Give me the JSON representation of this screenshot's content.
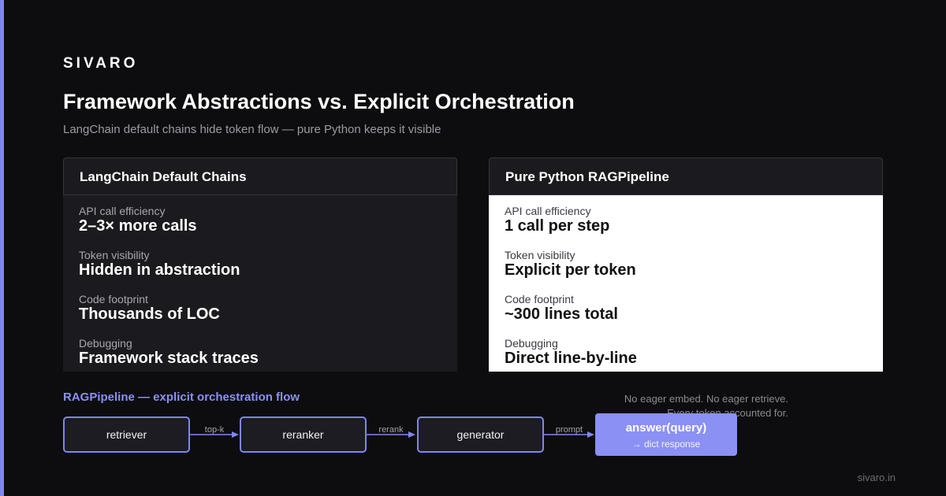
{
  "brand": "SIVARO",
  "title": "Framework Abstractions vs. Explicit Orchestration",
  "subtitle": "LangChain default chains hide token flow — pure Python keeps it visible",
  "panels": [
    {
      "heading": "LangChain Default Chains",
      "metrics": [
        {
          "label": "API call efficiency",
          "value": "2–3× more calls"
        },
        {
          "label": "Token visibility",
          "value": "Hidden in abstraction"
        },
        {
          "label": "Code footprint",
          "value": "Thousands of LOC"
        },
        {
          "label": "Debugging",
          "value": "Framework stack traces"
        }
      ]
    },
    {
      "heading": "Pure Python RAGPipeline",
      "metrics": [
        {
          "label": "API call efficiency",
          "value": "1 call per step"
        },
        {
          "label": "Token visibility",
          "value": "Explicit per token"
        },
        {
          "label": "Code footprint",
          "value": "~300 lines total"
        },
        {
          "label": "Debugging",
          "value": "Direct line-by-line"
        }
      ]
    }
  ],
  "flow": {
    "title": "RAGPipeline — explicit orchestration flow",
    "note_lines": [
      "No eager embed. No eager retrieve.",
      "Every token accounted for."
    ],
    "nodes": [
      "retriever",
      "reranker",
      "generator"
    ],
    "edges": [
      "top-k",
      "rerank",
      "prompt"
    ],
    "final": {
      "title": "answer(query)",
      "subtitle": "→ dict response"
    }
  },
  "footer": "sivaro.in",
  "colors": {
    "accent": "#7f86f2",
    "background": "#0d0d0f",
    "final_node": "#8b90f5"
  }
}
